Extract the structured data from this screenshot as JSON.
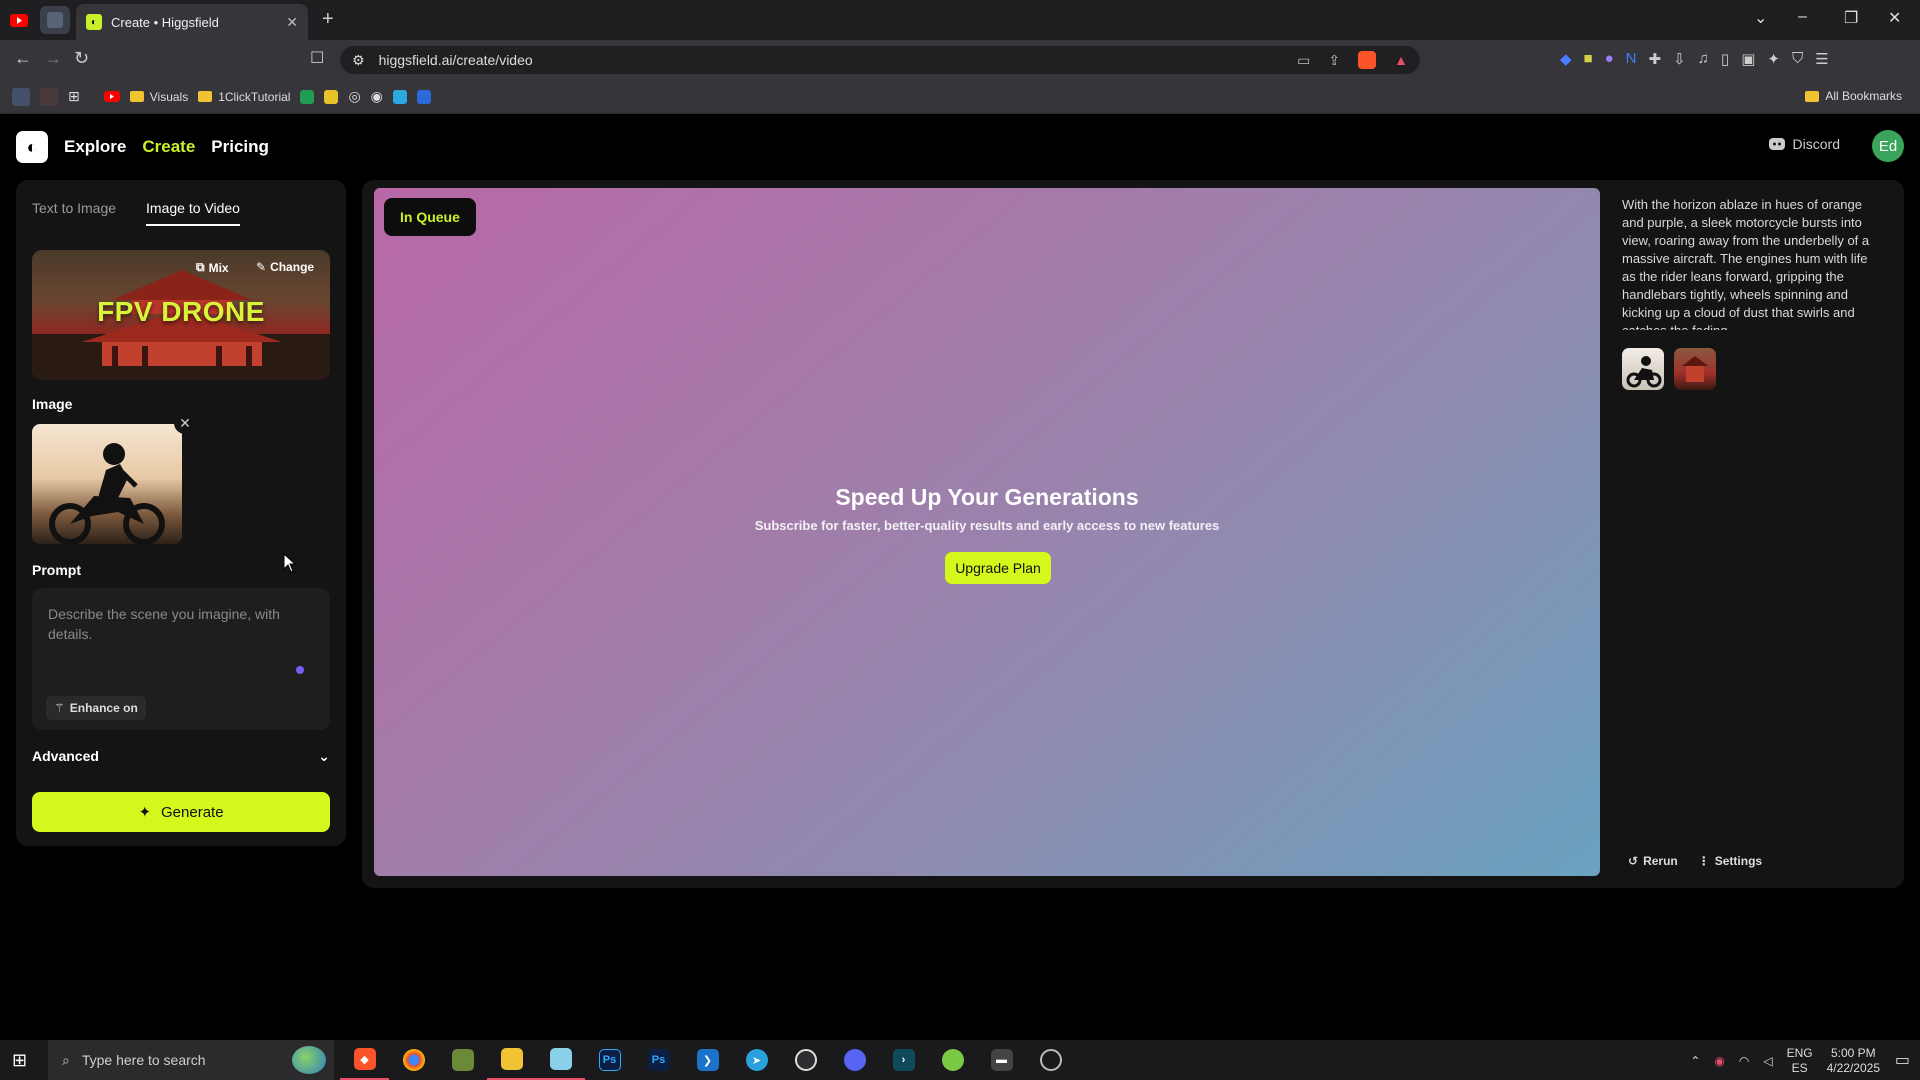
{
  "browser": {
    "tab_title": "Create • Higgsfield",
    "url": "higgsfield.ai/create/video",
    "bookmarks": [
      "Visuals",
      "1ClickTutorial"
    ],
    "all_bookmarks": "All Bookmarks"
  },
  "header": {
    "nav": [
      "Explore",
      "Create",
      "Pricing"
    ],
    "discord": "Discord",
    "avatar_initials": "Ed"
  },
  "left_panel": {
    "tabs": [
      "Text to Image",
      "Image to Video"
    ],
    "preset": {
      "title": "FPV DRONE",
      "mix_label": "Mix",
      "change_label": "Change"
    },
    "image_label": "Image",
    "prompt_label": "Prompt",
    "prompt_placeholder": "Describe the scene you imagine, with details.",
    "enhance_label": "Enhance on",
    "advanced_label": "Advanced",
    "generate_label": "Generate"
  },
  "main": {
    "status": "In Queue",
    "upsell_title": "Speed Up Your Generations",
    "upsell_subtitle": "Subscribe for faster, better-quality results and early access to new features",
    "upgrade_label": "Upgrade Plan",
    "description": "With the horizon ablaze in hues of orange and purple, a sleek motorcycle bursts into view, roaring away from the underbelly of a massive aircraft. The engines hum with life as the rider leans forward, gripping the handlebars tightly, wheels spinning and kicking up a cloud of dust that swirls and catches the fading",
    "rerun_label": "Rerun",
    "settings_label": "Settings"
  },
  "taskbar": {
    "search_placeholder": "Type here to search",
    "app_ps1": "Ps",
    "app_ps2": "Ps",
    "lang": "ENG",
    "layout": "ES",
    "time": "5:00 PM",
    "date": "4/22/2025"
  },
  "colors": {
    "accent": "#d4f81c",
    "brand_green": "#c9f02a"
  }
}
